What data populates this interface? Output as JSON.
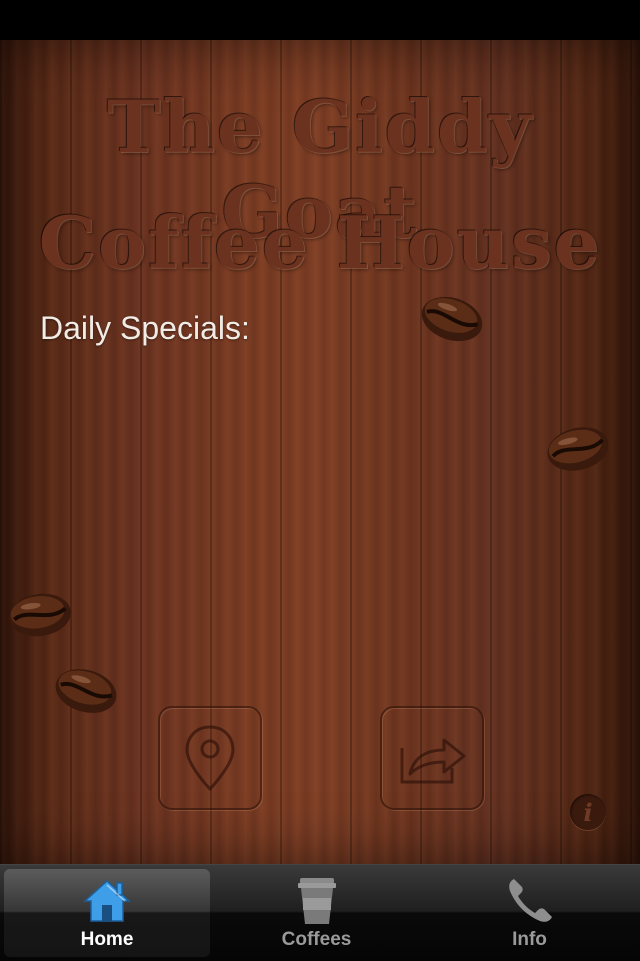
{
  "header": {
    "title_line_1": "The Giddy Goat",
    "title_line_2": "Coffee House"
  },
  "main": {
    "daily_specials_label": "Daily Specials:",
    "map_button_icon": "map-pin-icon",
    "share_button_icon": "share-arrow-icon",
    "info_button_icon": "info-icon"
  },
  "tab_bar": {
    "tabs": [
      {
        "label": "Home",
        "icon": "home-icon",
        "selected": true
      },
      {
        "label": "Coffees",
        "icon": "coffee-cup-icon",
        "selected": false
      },
      {
        "label": "Info",
        "icon": "phone-icon",
        "selected": false
      }
    ]
  },
  "colors": {
    "wood": "#6b3220",
    "selected_tab_text": "#ffffff",
    "tab_text": "#9a9a9a",
    "home_icon_blue": "#3f9ee8"
  }
}
